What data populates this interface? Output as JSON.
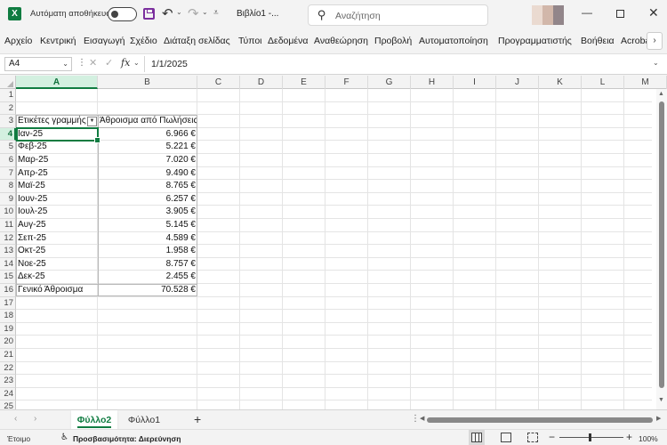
{
  "titlebar": {
    "app_logo": "X",
    "autosave_label": "Αυτόματη αποθήκευση",
    "doc_title": "Βιβλίο1  -...",
    "search_placeholder": "Αναζήτηση",
    "minimize": "—",
    "close": "✕"
  },
  "ribbon": {
    "tabs": [
      "Αρχείο",
      "Κεντρική",
      "Εισαγωγή",
      "Σχέδιο",
      "Διάταξη σελίδας",
      "Τύποι",
      "Δεδομένα",
      "Αναθεώρηση",
      "Προβολή",
      "Αυτοματοποίηση",
      "Προγραμματιστής",
      "Βοήθεια",
      "Acroba"
    ]
  },
  "formula_bar": {
    "name_box": "A4",
    "fx": "fx",
    "content": "1/1/2025"
  },
  "grid": {
    "columns": [
      "A",
      "B",
      "C",
      "D",
      "E",
      "F",
      "G",
      "H",
      "I",
      "J",
      "K",
      "L",
      "M"
    ],
    "rows": [
      "1",
      "2",
      "3",
      "4",
      "5",
      "6",
      "7",
      "8",
      "9",
      "10",
      "11",
      "12",
      "13",
      "14",
      "15",
      "16",
      "17",
      "18",
      "19",
      "20",
      "21",
      "22",
      "23",
      "24",
      "25"
    ],
    "active_column": "A",
    "active_row": "4"
  },
  "pivot": {
    "header_labels": "Ετικέτες γραμμής",
    "header_values": "Άθροισμα από Πωλήσεις",
    "rows": [
      {
        "label": "Ιαν-25",
        "value": "6.966 €"
      },
      {
        "label": "Φεβ-25",
        "value": "5.221 €"
      },
      {
        "label": "Μαρ-25",
        "value": "7.020 €"
      },
      {
        "label": "Απρ-25",
        "value": "9.490 €"
      },
      {
        "label": "Μαϊ-25",
        "value": "8.765 €"
      },
      {
        "label": "Ιουν-25",
        "value": "6.257 €"
      },
      {
        "label": "Ιουλ-25",
        "value": "3.905 €"
      },
      {
        "label": "Αυγ-25",
        "value": "5.145 €"
      },
      {
        "label": "Σεπ-25",
        "value": "4.589 €"
      },
      {
        "label": "Οκτ-25",
        "value": "1.958 €"
      },
      {
        "label": "Νοε-25",
        "value": "8.757 €"
      },
      {
        "label": "Δεκ-25",
        "value": "2.455 €"
      }
    ],
    "total_label": "Γενικό Άθροισμα",
    "total_value": "70.528 €"
  },
  "sheets": {
    "tabs": [
      "Φύλλο2",
      "Φύλλο1"
    ],
    "active": "Φύλλο2",
    "add": "+"
  },
  "statusbar": {
    "ready": "Έτοιμο",
    "accessibility": "Προσβασιμότητα: Διερεύνηση",
    "zoom": "100%"
  },
  "colors": {
    "accent": "#107c41",
    "save_icon": "#7b2f9e"
  }
}
